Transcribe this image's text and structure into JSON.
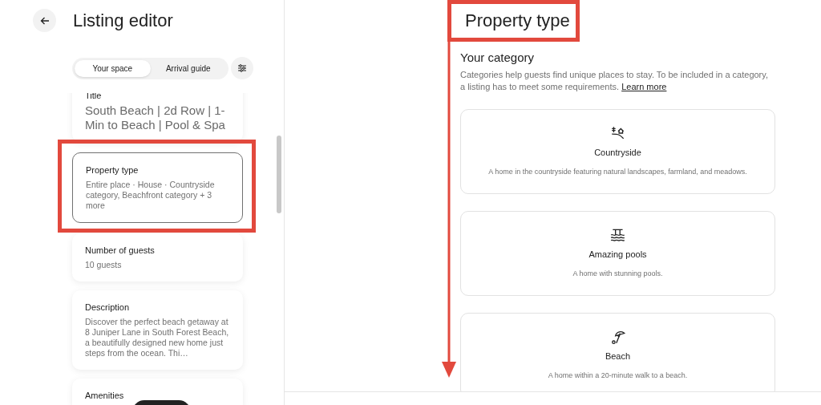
{
  "header": {
    "title": "Listing editor"
  },
  "tabs": [
    {
      "label": "Your space",
      "selected": true
    },
    {
      "label": "Arrival guide",
      "selected": false
    }
  ],
  "sections": [
    {
      "label": "Title",
      "value": "South Beach | 2d Row | 1-Min to Beach | Pool & Spa",
      "kind": "title",
      "selected": false,
      "highlighted": false
    },
    {
      "label": "Property type",
      "value": "Entire place · House · Countryside category, Beachfront category + 3 more",
      "kind": "text",
      "selected": true,
      "highlighted": true
    },
    {
      "label": "Number of guests",
      "value": "10 guests",
      "kind": "text",
      "selected": false,
      "highlighted": false
    },
    {
      "label": "Description",
      "value": "Discover the perfect beach getaway at 8 Juniper Lane in South Forest Beach, a beautifully designed new home just steps from the ocean. Thi…",
      "kind": "text",
      "selected": false,
      "highlighted": false
    },
    {
      "label": "Amenities",
      "kind": "text",
      "selected": false,
      "highlighted": false
    }
  ],
  "main": {
    "heading": "Property type",
    "heading_highlighted": true,
    "scroll_arrow": true,
    "subheading": "Your category",
    "intro": "Categories help guests find unique places to stay. To be included in a category, a listing has to meet some requirements.",
    "link": "Learn more",
    "categories": [
      {
        "kind": "countryside",
        "name": "Countryside",
        "description": "A home in the countryside featuring natural landscapes, farmland, and meadows."
      },
      {
        "kind": "pools",
        "name": "Amazing pools",
        "description": "A home with stunning pools."
      },
      {
        "kind": "beach",
        "name": "Beach",
        "description": "A home within a 20-minute walk to a beach."
      }
    ]
  }
}
